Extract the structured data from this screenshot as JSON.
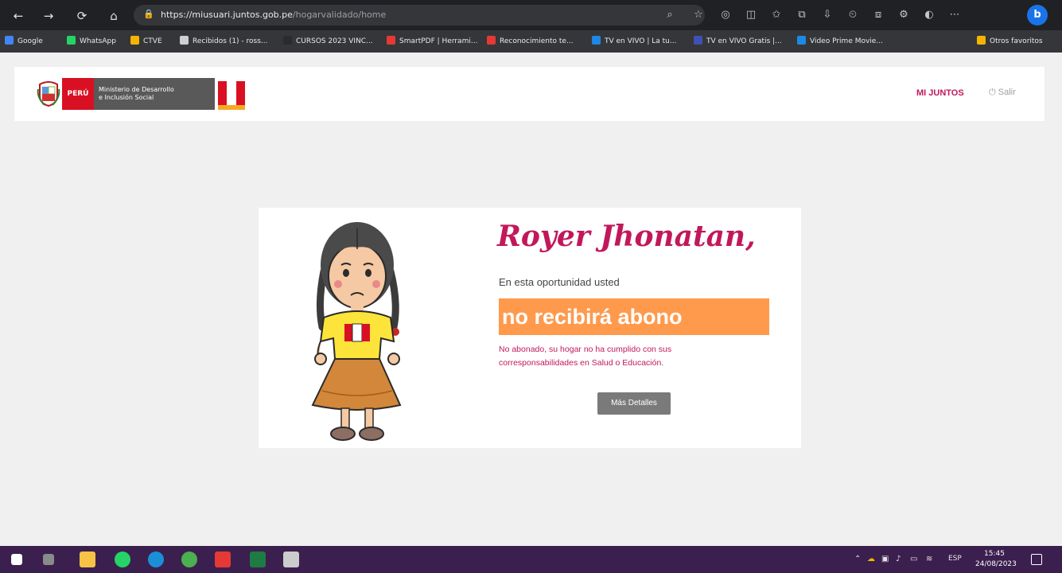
{
  "browser": {
    "nav": {
      "back": "←",
      "forward": "→",
      "reload": "⟳",
      "home": "⌂"
    },
    "url_host": "https://miusuari.juntos.gob.pe",
    "url_path": "/hogarvalidado/home",
    "toolbar_icons": [
      "zoom-icon",
      "star-icon",
      "refresh-circle-icon",
      "split-screen-icon",
      "favorites-icon",
      "collections-icon",
      "download-icon",
      "history-icon",
      "extensions-icon",
      "settings-icon",
      "copilot-icon",
      "more-icon"
    ],
    "profile_initial": "b",
    "bookmarks": [
      {
        "label": "Google",
        "color": "#4285f4"
      },
      {
        "label": "WhatsApp",
        "color": "#25d366"
      },
      {
        "label": "CTVE",
        "color": "#f4b400"
      },
      {
        "label": "Recibidos (1) - ross...",
        "color": "#cfcfcf"
      },
      {
        "label": "CURSOS 2023 VINC...",
        "color": "#2b2b2b"
      },
      {
        "label": "SmartPDF | Herrami...",
        "color": "#e53935"
      },
      {
        "label": "Reconocimiento te...",
        "color": "#e53935"
      },
      {
        "label": "TV en VIVO | La tu...",
        "color": "#1e88e5"
      },
      {
        "label": "TV en VIVO Gratis |...",
        "color": "#3f51b5"
      },
      {
        "label": "Video Prime Movie...",
        "color": "#1e88e5"
      },
      {
        "label": "Otros favoritos",
        "color": "#f4b400"
      }
    ]
  },
  "header": {
    "logo": {
      "country": "PERÚ",
      "ministry_line1": "Ministerio de Desarrollo",
      "ministry_line2": "e Inclusión Social"
    },
    "nav_mi_juntos": "MI JUNTOS",
    "nav_salir": "Salir"
  },
  "card": {
    "greeting": "Royer Jhonatan,",
    "subtitle": "En esta oportunidad usted",
    "result": "no recibirá abono",
    "reason": "No abonado, su hogar no ha cumplido con sus corresponsabilidades en Salud o Educación.",
    "details_button": "Más Detalles"
  },
  "taskbar": {
    "apps": [
      {
        "name": "start-icon",
        "color": "#ffffff"
      },
      {
        "name": "task-view-icon",
        "color": "#8a8a8a"
      },
      {
        "name": "file-explorer-icon",
        "color": "#f6c344"
      },
      {
        "name": "whatsapp-icon",
        "color": "#25d366"
      },
      {
        "name": "edge-icon",
        "color": "#1a8fd8"
      },
      {
        "name": "chrome-icon",
        "color": "#4caf50"
      },
      {
        "name": "acrobat-icon",
        "color": "#e53935"
      },
      {
        "name": "excel-icon",
        "color": "#1e7b45"
      },
      {
        "name": "settings-icon",
        "color": "#cccccc"
      }
    ],
    "lang": "ESP",
    "time": "15:45",
    "date": "24/08/2023"
  },
  "colors": {
    "accent": "#c2185b",
    "banner": "#ff9a4d",
    "taskbar": "#3b1f4f"
  }
}
